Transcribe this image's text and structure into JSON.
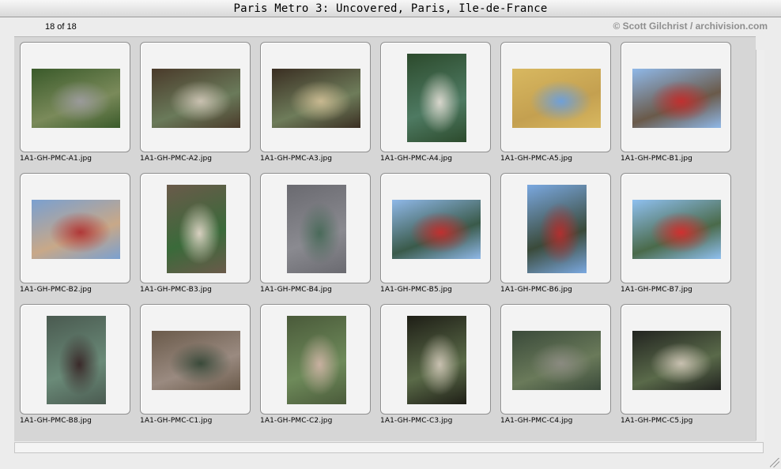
{
  "window": {
    "title": "Paris Metro 3: Uncovered, Paris, Ile-de-France"
  },
  "info": {
    "page_count": "18 of 18",
    "copyright": "© Scott Gilchrist / archivision.com"
  },
  "thumbnails": [
    {
      "filename": "1A1-GH-PMC-A1.jpg",
      "orientation": "landscape",
      "colors": [
        "#3a5a2a",
        "#7a8a5a",
        "#9a9a9a"
      ]
    },
    {
      "filename": "1A1-GH-PMC-A2.jpg",
      "orientation": "landscape",
      "colors": [
        "#4a3a2a",
        "#6a7a5a",
        "#c9c0b0"
      ]
    },
    {
      "filename": "1A1-GH-PMC-A3.jpg",
      "orientation": "landscape",
      "colors": [
        "#3a2e22",
        "#6e7c5a",
        "#c8b890"
      ]
    },
    {
      "filename": "1A1-GH-PMC-A4.jpg",
      "orientation": "portrait",
      "colors": [
        "#2c4a2c",
        "#4e7a62",
        "#d8d6cc"
      ]
    },
    {
      "filename": "1A1-GH-PMC-A5.jpg",
      "orientation": "landscape",
      "colors": [
        "#d8b860",
        "#c4a050",
        "#6fa0d8"
      ]
    },
    {
      "filename": "1A1-GH-PMC-B1.jpg",
      "orientation": "landscape",
      "colors": [
        "#8fb8e8",
        "#6a5a4a",
        "#c03030"
      ]
    },
    {
      "filename": "1A1-GH-PMC-B2.jpg",
      "orientation": "landscape",
      "colors": [
        "#7aa0d0",
        "#c8a888",
        "#b03838"
      ]
    },
    {
      "filename": "1A1-GH-PMC-B3.jpg",
      "orientation": "portrait",
      "colors": [
        "#6a5a4a",
        "#3a6a3a",
        "#d8d0c0"
      ]
    },
    {
      "filename": "1A1-GH-PMC-B4.jpg",
      "orientation": "portrait",
      "colors": [
        "#6a6a70",
        "#8a8a90",
        "#4a6a5a"
      ]
    },
    {
      "filename": "1A1-GH-PMC-B5.jpg",
      "orientation": "landscape",
      "colors": [
        "#8fb8e8",
        "#3a5a4a",
        "#c03030"
      ]
    },
    {
      "filename": "1A1-GH-PMC-B6.jpg",
      "orientation": "portrait",
      "colors": [
        "#7aa8e0",
        "#3a4a3a",
        "#b03030"
      ]
    },
    {
      "filename": "1A1-GH-PMC-B7.jpg",
      "orientation": "landscape",
      "colors": [
        "#8fc0f0",
        "#4a6a4a",
        "#d03030"
      ]
    },
    {
      "filename": "1A1-GH-PMC-B8.jpg",
      "orientation": "portrait",
      "colors": [
        "#4a5a50",
        "#6a8a78",
        "#3a2a2a"
      ]
    },
    {
      "filename": "1A1-GH-PMC-C1.jpg",
      "orientation": "landscape",
      "colors": [
        "#6a5a4a",
        "#9a8a80",
        "#3a4a3a"
      ]
    },
    {
      "filename": "1A1-GH-PMC-C2.jpg",
      "orientation": "portrait",
      "colors": [
        "#4a5a3a",
        "#6e8a5a",
        "#c8b0a0"
      ]
    },
    {
      "filename": "1A1-GH-PMC-C3.jpg",
      "orientation": "portrait",
      "colors": [
        "#1e1e16",
        "#5a6a48",
        "#c8c0b0"
      ]
    },
    {
      "filename": "1A1-GH-PMC-C4.jpg",
      "orientation": "landscape",
      "colors": [
        "#3a4a3a",
        "#6a7a5a",
        "#8a8a80"
      ]
    },
    {
      "filename": "1A1-GH-PMC-C5.jpg",
      "orientation": "landscape",
      "colors": [
        "#222420",
        "#5a6a4a",
        "#c8c0b0"
      ]
    }
  ]
}
